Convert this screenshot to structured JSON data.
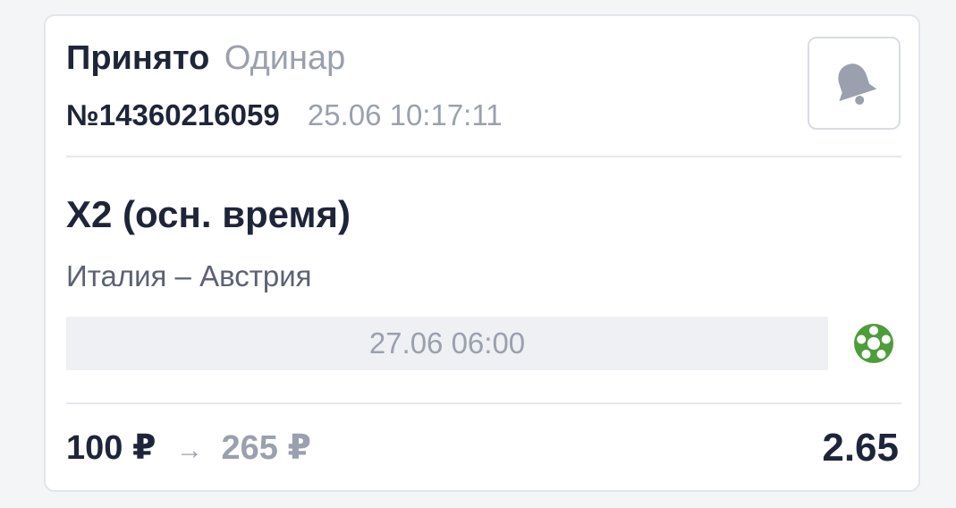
{
  "bet": {
    "status": "Принято",
    "type": "Одинар",
    "number": "№14360216059",
    "placed_at": "25.06 10:17:11"
  },
  "selection": {
    "outcome": "X2 (осн. время)",
    "event": "Италия – Австрия",
    "event_date": "27.06 06:00",
    "sport_icon": "football-icon"
  },
  "summary": {
    "stake": "100 ₽",
    "arrow": "→",
    "potential_win": "265 ₽",
    "odds": "2.65"
  },
  "icons": {
    "notifications": "bell-icon"
  },
  "colors": {
    "primary_text": "#1f2539",
    "secondary_text": "#9aa0ad",
    "sport_icon_green": "#4f9d3a"
  }
}
